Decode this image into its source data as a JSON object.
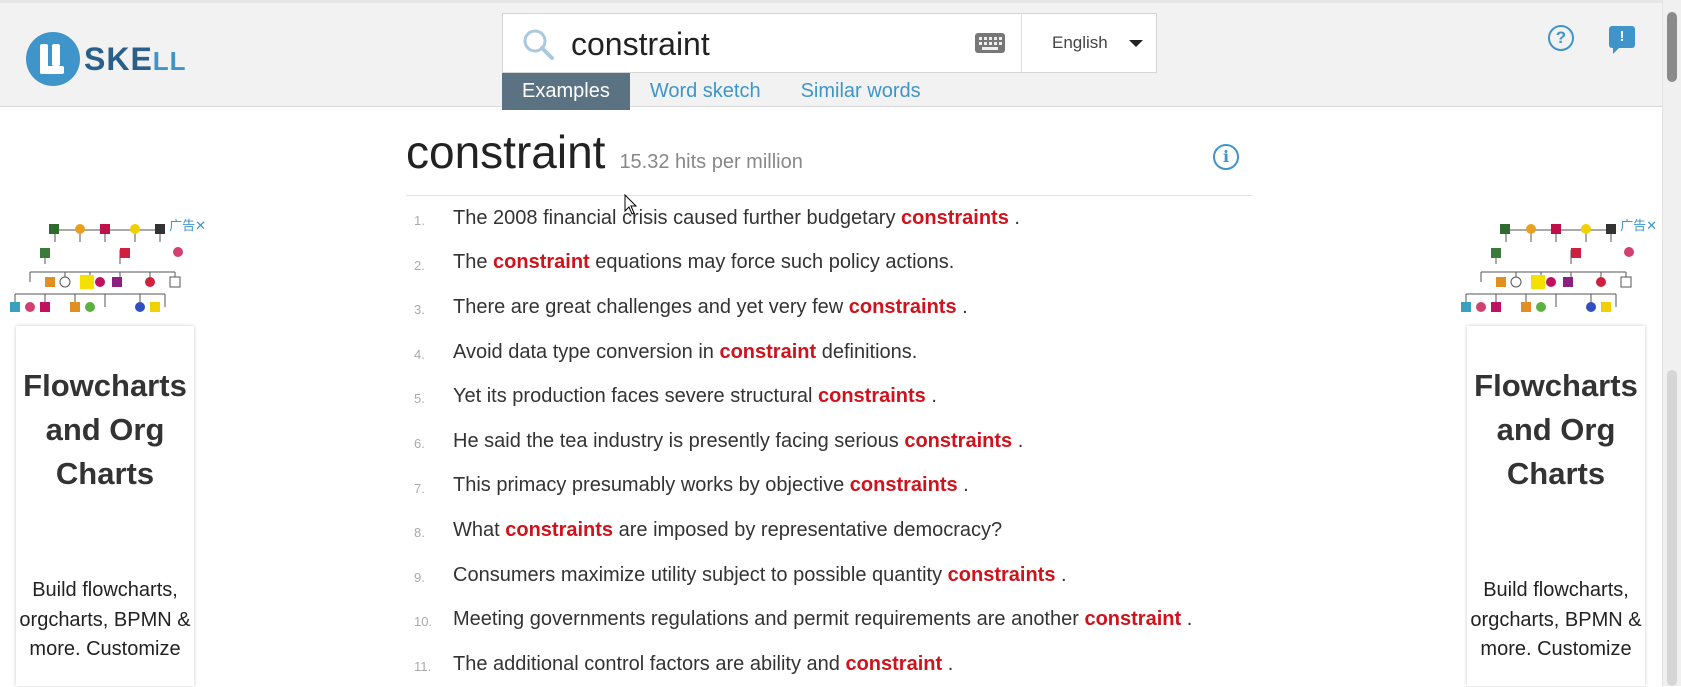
{
  "header": {
    "logo_text": "SKE",
    "logo_suffix": "LL",
    "search": {
      "value": "constraint"
    },
    "language": "English",
    "tabs": [
      {
        "label": "Examples",
        "active": true
      },
      {
        "label": "Word sketch",
        "active": false
      },
      {
        "label": "Similar words",
        "active": false
      }
    ],
    "help_glyph": "?",
    "feedback_glyph": "!"
  },
  "main": {
    "headword": "constraint",
    "hits": "15.32 hits per million",
    "info_glyph": "i",
    "examples": [
      {
        "num": "1.",
        "before": "The 2008 financial crisis caused further budgetary ",
        "keyword": "constraints",
        "after": " ."
      },
      {
        "num": "2.",
        "before": "The ",
        "keyword": "constraint",
        "after": " equations may force such policy actions."
      },
      {
        "num": "3.",
        "before": "There are great challenges and yet very few ",
        "keyword": "constraints",
        "after": " ."
      },
      {
        "num": "4.",
        "before": "Avoid data type conversion in ",
        "keyword": "constraint",
        "after": " definitions."
      },
      {
        "num": "5.",
        "before": "Yet its production faces severe structural ",
        "keyword": "constraints",
        "after": " ."
      },
      {
        "num": "6.",
        "before": "He said the tea industry is presently facing serious ",
        "keyword": "constraints",
        "after": " ."
      },
      {
        "num": "7.",
        "before": "This primacy presumably works by objective ",
        "keyword": "constraints",
        "after": " ."
      },
      {
        "num": "8.",
        "before": "What ",
        "keyword": "constraints",
        "after": " are imposed by representative democracy?"
      },
      {
        "num": "9.",
        "before": "Consumers maximize utility subject to possible quantity ",
        "keyword": "constraints",
        "after": " ."
      },
      {
        "num": "10.",
        "before": "Meeting governments regulations and permit requirements are another ",
        "keyword": "constraint",
        "after": " ."
      },
      {
        "num": "11.",
        "before": "The additional control factors are ability and ",
        "keyword": "constraint",
        "after": " ."
      }
    ]
  },
  "ads": {
    "badge": "广告",
    "close_glyph": "✕",
    "title": "Flowcharts and Org Charts",
    "body": "Build flowcharts, orgcharts, BPMN & more. Customize"
  },
  "colors": {
    "accent": "#3f95c9",
    "keyword": "#d0121b",
    "active_tab": "#5b7282"
  }
}
